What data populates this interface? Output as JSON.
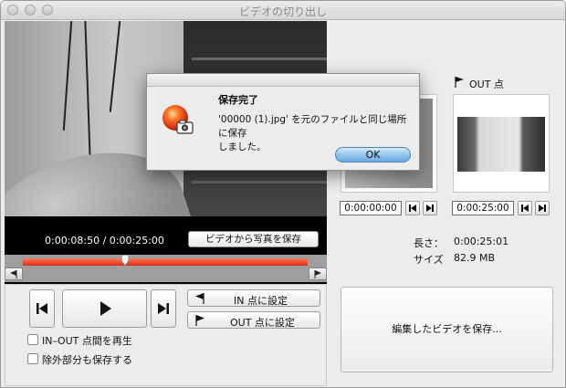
{
  "window": {
    "title": "ビデオの切り出し"
  },
  "player": {
    "time_display": "0:00:08:50 / 0:00:25:00",
    "save_photo_label": "ビデオから写真を保存",
    "in_point_label": "IN 点に設定",
    "out_point_label": "OUT 点に設定",
    "play_in_out_label": "IN–OUT 点間を再生",
    "save_excluded_label": "除外部分も保存する",
    "play_in_out_checked": false,
    "save_excluded_checked": false
  },
  "right": {
    "out_header": "OUT 点",
    "in_time": "0:00:00:00",
    "out_time": "0:00:25:00",
    "length_label": "長さ：",
    "length_value": "0:00:25:01",
    "size_label": "サイズ",
    "size_value": "82.9 MB",
    "save_video_label": "編集したビデオを保存..."
  },
  "dialog": {
    "title": "保存完了",
    "message_line1": "'00000 (1).jpg' を元のファイルと同じ場所に保存",
    "message_line2": "しました。",
    "ok_label": "OK"
  },
  "colors": {
    "scrub_fill": "#e22a12",
    "ok_button": "#8fc2ec"
  },
  "icons": [
    "photo-camera-app-icon",
    "skip-back-icon",
    "play-icon",
    "skip-forward-icon",
    "flag-left-icon",
    "flag-right-icon"
  ]
}
